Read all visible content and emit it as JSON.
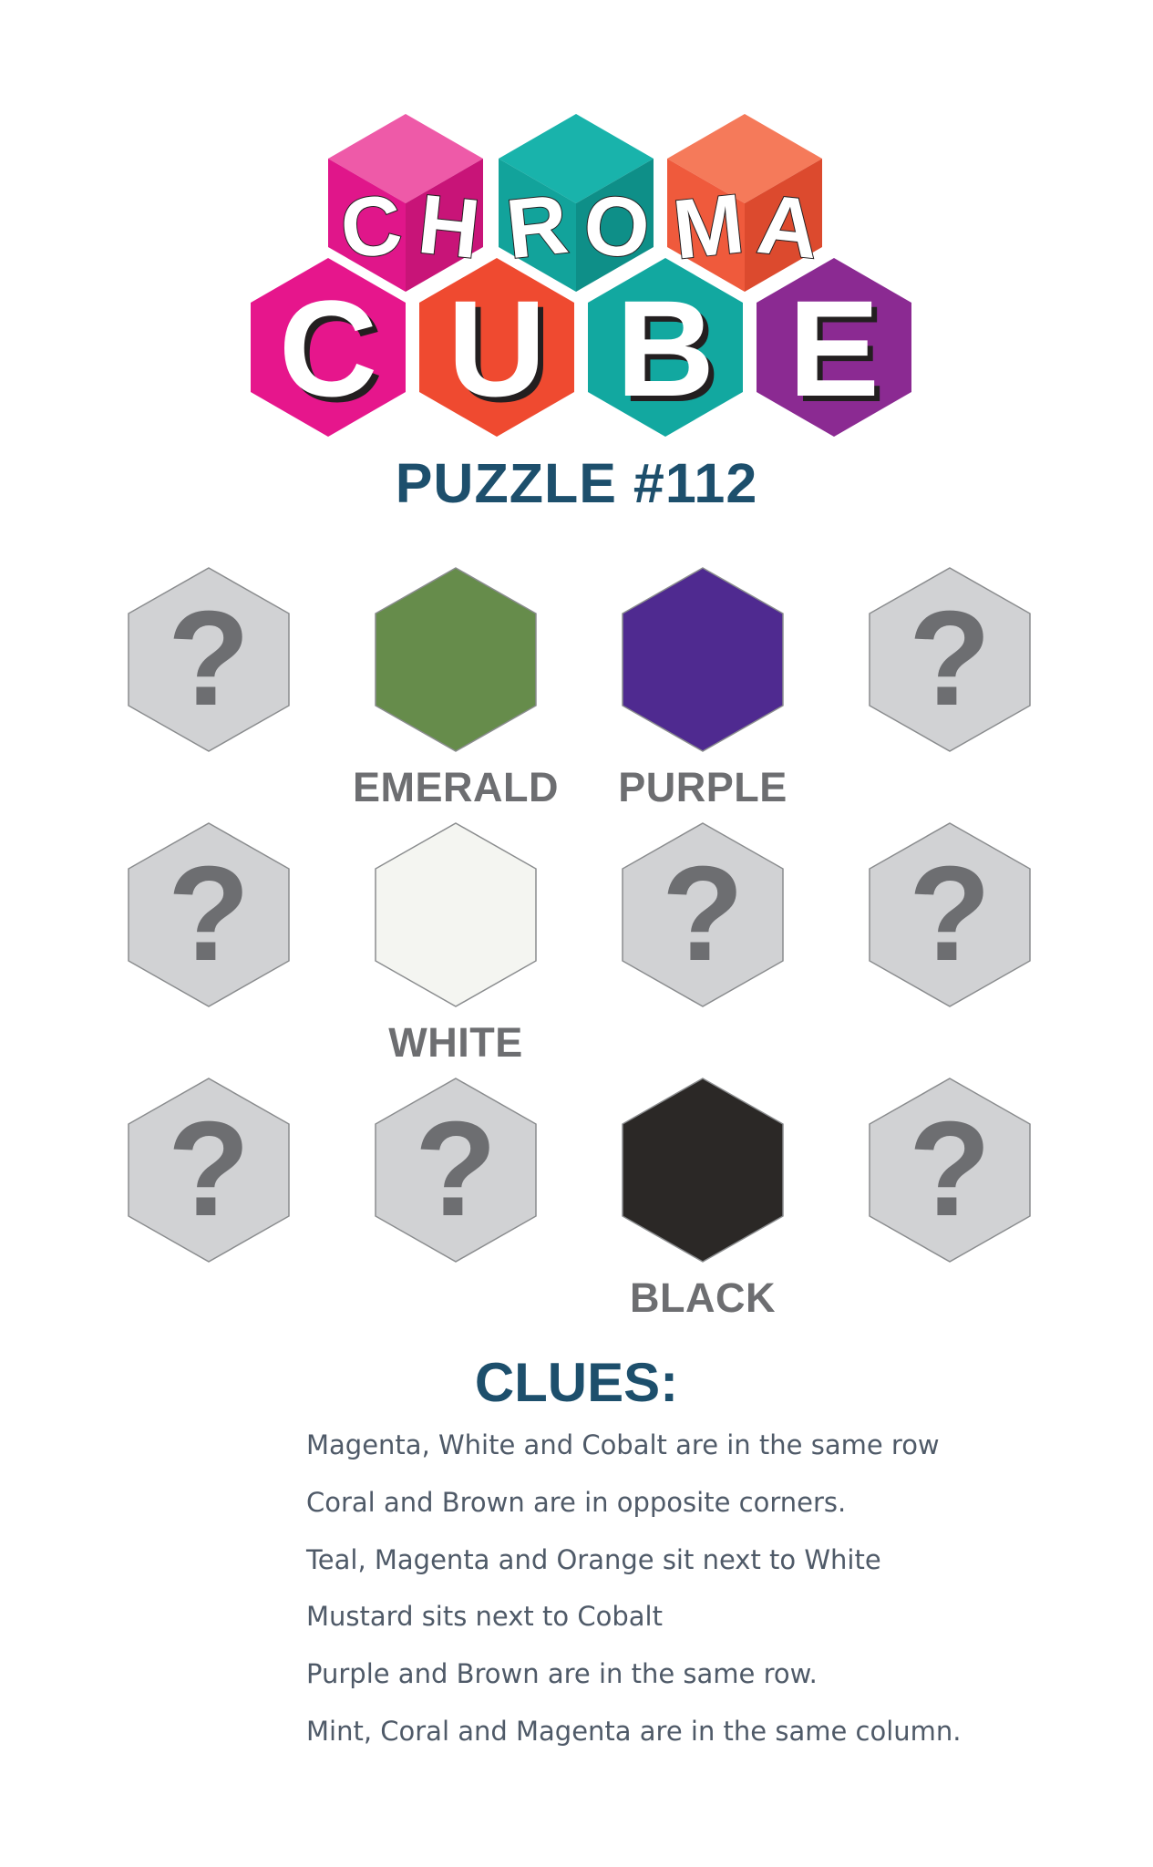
{
  "logo": {
    "word1": "CHROMA",
    "word2": "CUBE",
    "tile_colors": {
      "magenta": "#e6168c",
      "teal": "#12a8a0",
      "coral": "#ef5a3c",
      "purple": "#8b2a92"
    }
  },
  "puzzle": {
    "title": "PUZZLE #112"
  },
  "grid": {
    "unknown_symbol": "?",
    "unknown_fill": "#d1d2d4",
    "rows": [
      [
        {
          "type": "unknown"
        },
        {
          "type": "color",
          "label": "EMERALD",
          "fill": "#668c4b"
        },
        {
          "type": "color",
          "label": "PURPLE",
          "fill": "#4f2a90"
        },
        {
          "type": "unknown"
        }
      ],
      [
        {
          "type": "unknown"
        },
        {
          "type": "color",
          "label": "WHITE",
          "fill": "#f4f5f1"
        },
        {
          "type": "unknown"
        },
        {
          "type": "unknown"
        }
      ],
      [
        {
          "type": "unknown"
        },
        {
          "type": "unknown"
        },
        {
          "type": "color",
          "label": "BLACK",
          "fill": "#2b2826"
        },
        {
          "type": "unknown"
        }
      ]
    ]
  },
  "clues": {
    "title": "CLUES:",
    "items": [
      "Magenta, White and Cobalt are in the same row",
      "Coral and Brown are in opposite corners.",
      "Teal, Magenta and Orange sit next to White",
      "Mustard sits next to Cobalt",
      "Purple and Brown are in the same row.",
      "Mint, Coral and Magenta are in the same column."
    ]
  }
}
